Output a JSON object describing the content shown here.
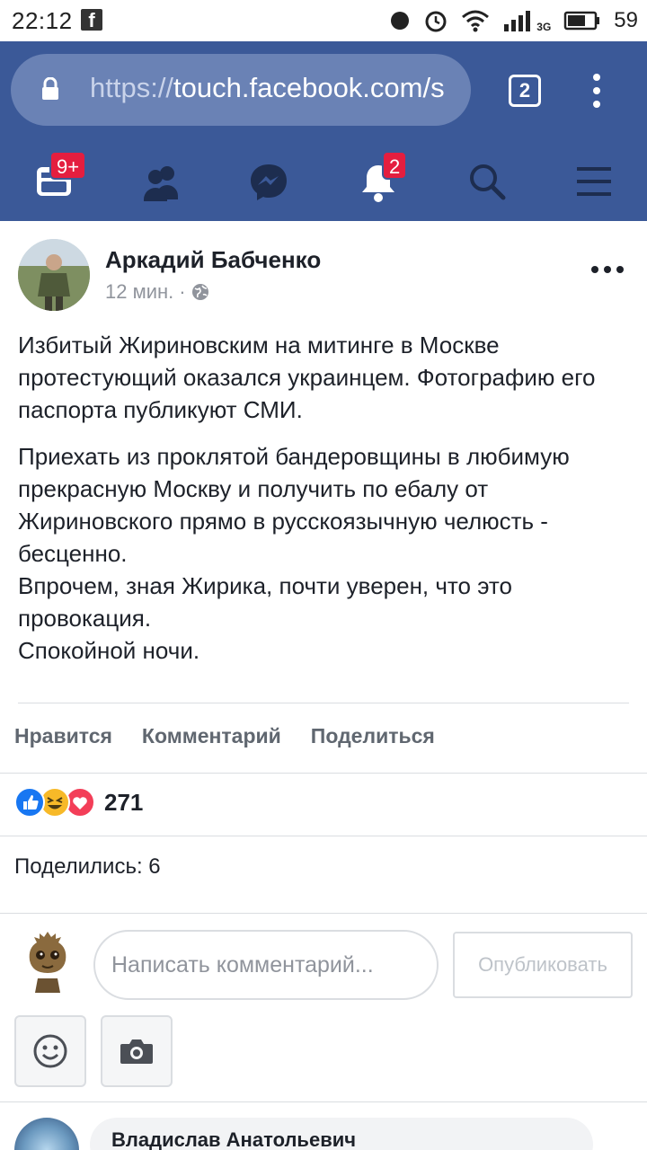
{
  "status_bar": {
    "time": "22:12",
    "notif_icon": "facebook-notification-icon",
    "network": "3G",
    "battery": "59"
  },
  "browser": {
    "url_scheme": "https://",
    "url_host": "touch.facebook.com/s",
    "tab_count": "2"
  },
  "fb_nav": {
    "feed_badge": "9+",
    "notifications_badge": "2"
  },
  "post": {
    "author": "Аркадий Бабченко",
    "time": "12 мин.",
    "separator": "·",
    "privacy_icon": "globe-icon",
    "paragraphs": [
      "Избитый Жириновским на митинге в Москве протестующий оказался украинцем. Фотографию его паспорта публикуют СМИ.",
      "Приехать из проклятой бандеровщины в любимую прекрасную Москву и получить по ебалу от Жириновского прямо в русскоязычную челюсть - бесценно.\nВпрочем, зная Жирика, почти уверен, что это провокация.\nСпокойной ночи."
    ]
  },
  "actions": {
    "like": "Нравится",
    "comment": "Комментарий",
    "share": "Поделиться"
  },
  "reactions": {
    "count": "271",
    "types": [
      "like",
      "haha",
      "love"
    ]
  },
  "shares": "Поделились: 6",
  "comment_box": {
    "placeholder": "Написать комментарий...",
    "publish": "Опубликовать"
  },
  "comment_preview": {
    "author": "Владислав Анатольевич"
  },
  "colors": {
    "brand": "#3b5998",
    "badge": "#e41e3f",
    "like": "#1877f2",
    "haha": "#f7b928",
    "love": "#f33e58"
  }
}
